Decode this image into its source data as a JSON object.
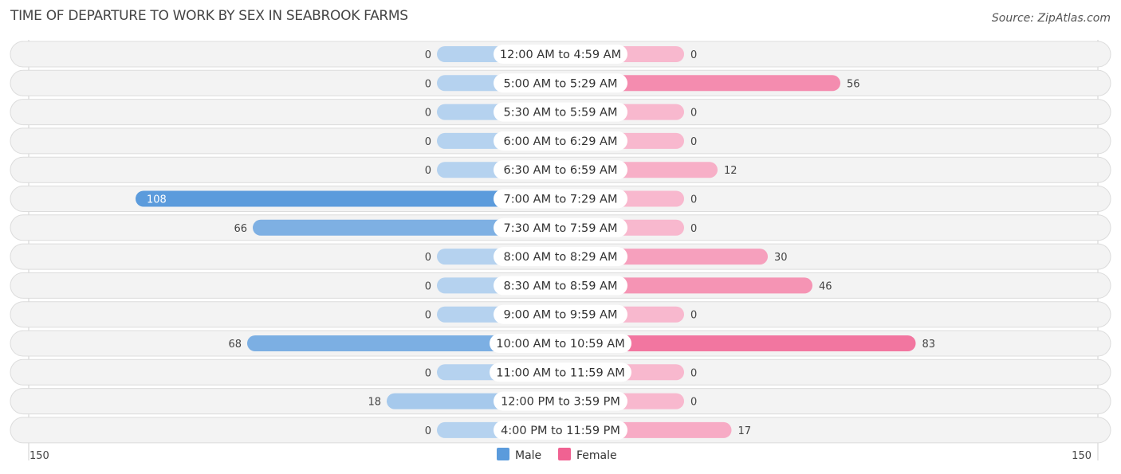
{
  "chart_data": {
    "type": "bar",
    "orientation": "horizontal-diverging",
    "title": "TIME OF DEPARTURE TO WORK BY SEX IN SEABROOK FARMS",
    "source": "Source: ZipAtlas.com",
    "categories": [
      "12:00 AM to 4:59 AM",
      "5:00 AM to 5:29 AM",
      "5:30 AM to 5:59 AM",
      "6:00 AM to 6:29 AM",
      "6:30 AM to 6:59 AM",
      "7:00 AM to 7:29 AM",
      "7:30 AM to 7:59 AM",
      "8:00 AM to 8:29 AM",
      "8:30 AM to 8:59 AM",
      "9:00 AM to 9:59 AM",
      "10:00 AM to 10:59 AM",
      "11:00 AM to 11:59 AM",
      "12:00 PM to 3:59 PM",
      "4:00 PM to 11:59 PM"
    ],
    "series": [
      {
        "name": "Male",
        "color": "#5b9bdc",
        "values": [
          0,
          0,
          0,
          0,
          0,
          108,
          66,
          0,
          0,
          0,
          68,
          0,
          18,
          0
        ]
      },
      {
        "name": "Female",
        "color": "#f06292",
        "values": [
          0,
          56,
          0,
          0,
          12,
          0,
          0,
          30,
          46,
          0,
          83,
          0,
          0,
          17
        ]
      }
    ],
    "axis": {
      "left_label": "150",
      "right_label": "150",
      "max": 150
    },
    "legend": {
      "position": "bottom-center",
      "items": [
        "Male",
        "Female"
      ]
    },
    "grid": false
  }
}
